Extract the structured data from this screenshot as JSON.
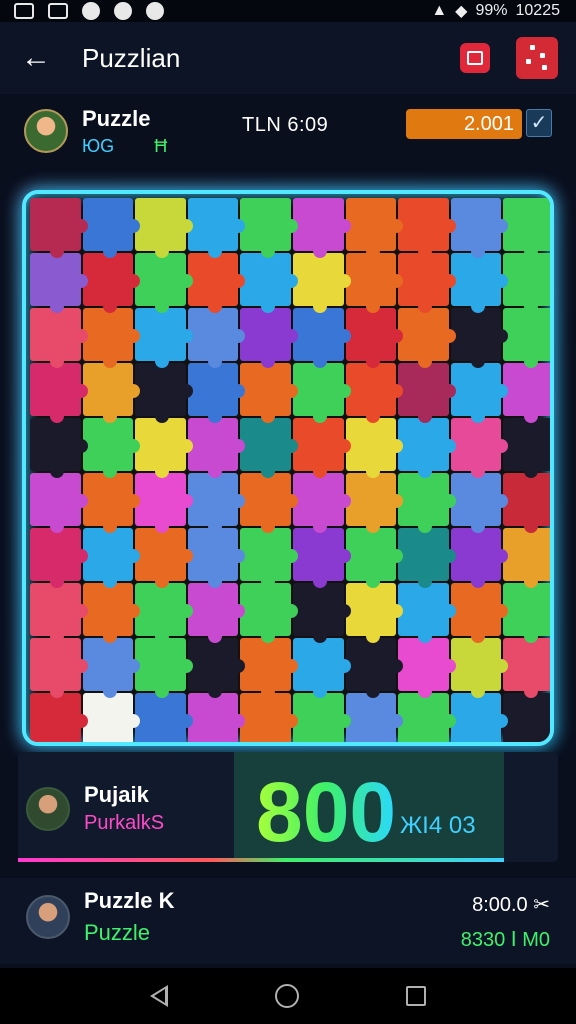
{
  "status_bar": {
    "battery": "99%",
    "time": "10225"
  },
  "app_bar": {
    "title": "Puzzlian"
  },
  "player_header": {
    "name": "Puzzle",
    "sub_left": "ЮG",
    "sub_right": "Ħ",
    "timer": "TLN 6:09",
    "score": "2.001"
  },
  "board": {
    "colors": [
      "#b62a52",
      "#3a76d6",
      "#c8d83a",
      "#2aa8e8",
      "#3fd05a",
      "#c84ad0",
      "#e86a22",
      "#e84a2a",
      "#5a8ae0",
      "#3fd05a",
      "#8a5ad0",
      "#d62a3a",
      "#3fd05a",
      "#e84a2a",
      "#2aa8e8",
      "#e8d83a",
      "#e86a22",
      "#e84a2a",
      "#2aa8e8",
      "#3fd05a",
      "#e84a6a",
      "#e86a22",
      "#2aa8e8",
      "#5a8ae0",
      "#8a3ad0",
      "#3a76d6",
      "#d62a3a",
      "#e86a22",
      "#1a1a2a",
      "#3fd05a",
      "#d62a6a",
      "#e8a02a",
      "#1a1a2a",
      "#3a76d6",
      "#e86a22",
      "#3fd05a",
      "#e84a2a",
      "#a82a5a",
      "#2aa8e8",
      "#c84ad0",
      "#1a1a2a",
      "#3fd05a",
      "#e8d83a",
      "#c84ad0",
      "#1a8a8a",
      "#e84a2a",
      "#e8d83a",
      "#2aa8e8",
      "#e84a9a",
      "#1a1a2a",
      "#c84ad0",
      "#e86a22",
      "#e84ad0",
      "#5a8ae0",
      "#e86a22",
      "#c84ad0",
      "#e8a02a",
      "#3fd05a",
      "#5a8ae0",
      "#c82a3a",
      "#d62a6a",
      "#2aa8e8",
      "#e86a22",
      "#5a8ae0",
      "#3fd05a",
      "#8a3ad0",
      "#3fd05a",
      "#1a8a8a",
      "#8a3ad0",
      "#e8a02a",
      "#e84a6a",
      "#e86a22",
      "#3fd05a",
      "#c84ad0",
      "#3fd05a",
      "#1a1a2a",
      "#e8d83a",
      "#2aa8e8",
      "#e86a22",
      "#3fd05a",
      "#e84a6a",
      "#5a8ae0",
      "#3fd05a",
      "#1a1a2a",
      "#e86a22",
      "#2aa8e8",
      "#1a1a2a",
      "#e84ad0",
      "#c8d83a",
      "#e84a6a",
      "#d62a3a",
      "#f4f4ee",
      "#3a76d6",
      "#c84ad0",
      "#e86a22",
      "#3fd05a",
      "#5a8ae0",
      "#3fd05a",
      "#2aa8e8",
      "#1a1a2a"
    ]
  },
  "leaderboard": {
    "name": "Pujaik",
    "sub": "PurkalkS",
    "big_score": "800",
    "small_score": "ЖI4   03"
  },
  "bottom_row": {
    "name": "Puzzle K",
    "sub": "Puzzle",
    "val1": "8:00.0 ✂",
    "val2": "8330 Ⅰ М0"
  }
}
